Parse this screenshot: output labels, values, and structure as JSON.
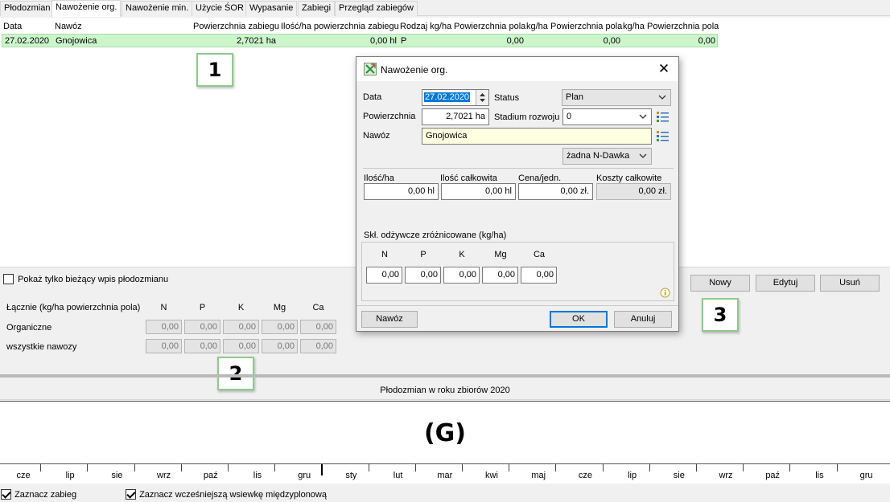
{
  "tabs": [
    {
      "label": "Płodozmian"
    },
    {
      "label": "Nawożenie org."
    },
    {
      "label": "Nawożenie min."
    },
    {
      "label": "Użycie ŚOR"
    },
    {
      "label": "Wypasanie"
    },
    {
      "label": "Zabiegi"
    },
    {
      "label": "Przegląd zabiegów"
    }
  ],
  "table": {
    "headers": [
      "Data",
      "Nawóz",
      "Powierzchnia zabiegu",
      "Ilość/ha powierzchnia zabiegu",
      "Rodzaj kg/ha",
      "Powierzchnia pola",
      "kg/ha",
      "Powierzchnia pola",
      "kg/ha",
      "Powierzchnia pola"
    ],
    "row": {
      "date": "27.02.2020",
      "fertilizer": "Gnojowica",
      "area": "2,7021 ha",
      "qty": "0,00 hl",
      "type": "P",
      "v1": "0,00",
      "v2": "0,00",
      "v3": "0,00"
    }
  },
  "callouts": {
    "one": "1",
    "two": "2",
    "three": "3"
  },
  "show_current_label": "Pokaż tylko bieżący wpis płodozmianu",
  "summary": {
    "title": "Łącznie (kg/ha powierzchnia pola)",
    "heads": [
      "N",
      "P",
      "K",
      "Mg",
      "Ca"
    ],
    "rows": [
      {
        "label": "Organiczne",
        "values": [
          "0,00",
          "0,00",
          "0,00",
          "0,00",
          "0,00"
        ]
      },
      {
        "label": "wszystkie nawozy",
        "values": [
          "0,00",
          "0,00",
          "0,00",
          "0,00",
          "0,00"
        ]
      }
    ]
  },
  "buttons": {
    "new": "Nowy",
    "edit": "Edytuj",
    "delete": "Usuń"
  },
  "strip_title": "Płodozmian w roku zbiorów 2020",
  "g_label": "(G)",
  "months": [
    "cze",
    "lip",
    "sie",
    "wrz",
    "paź",
    "lis",
    "gru",
    "sty",
    "lut",
    "mar",
    "kwi",
    "maj",
    "cze",
    "lip",
    "sie",
    "wrz",
    "paź",
    "lis",
    "gru"
  ],
  "bottom": {
    "mark_treatment": "Zaznacz zabieg",
    "mark_earlier": "Zaznacz wcześniejszą wsiewkę międzyplonową"
  },
  "dialog": {
    "title": "Nawożenie org.",
    "date_label": "Data",
    "date_value": "27.02.2020",
    "status_label": "Status",
    "status_value": "Plan",
    "area_label": "Powierzchnia",
    "area_value": "2,7021 ha",
    "stage_label": "Stadium rozwoju",
    "stage_value": "0",
    "fert_label": "Nawóz",
    "fert_value": "Gnojowica",
    "ndawka_value": "żadna N-Dawka",
    "qty_ha_label": "Ilość/ha",
    "qty_ha_value": "0,00 hl",
    "qty_total_label": "Ilość całkowita",
    "qty_total_value": "0,00 hl",
    "price_label": "Cena/jedn.",
    "price_value": "0,00 zł.",
    "cost_label": "Koszty całkowite",
    "cost_value": "0,00 zł.",
    "nutrients_label": "Skł. odżywcze zróżnicowane (kg/ha)",
    "nutrient_heads": [
      "N",
      "P",
      "K",
      "Mg",
      "Ca"
    ],
    "nutrient_values": [
      "0,00",
      "0,00",
      "0,00",
      "0,00",
      "0,00"
    ],
    "btn_fert": "Nawóz",
    "btn_ok": "OK",
    "btn_cancel": "Anuluj"
  },
  "colors": {
    "selected_row": "#ccf5cc",
    "callout_border": "#8fc98f",
    "fert_field": "#ffffe1",
    "ok_border": "#0078d7"
  }
}
